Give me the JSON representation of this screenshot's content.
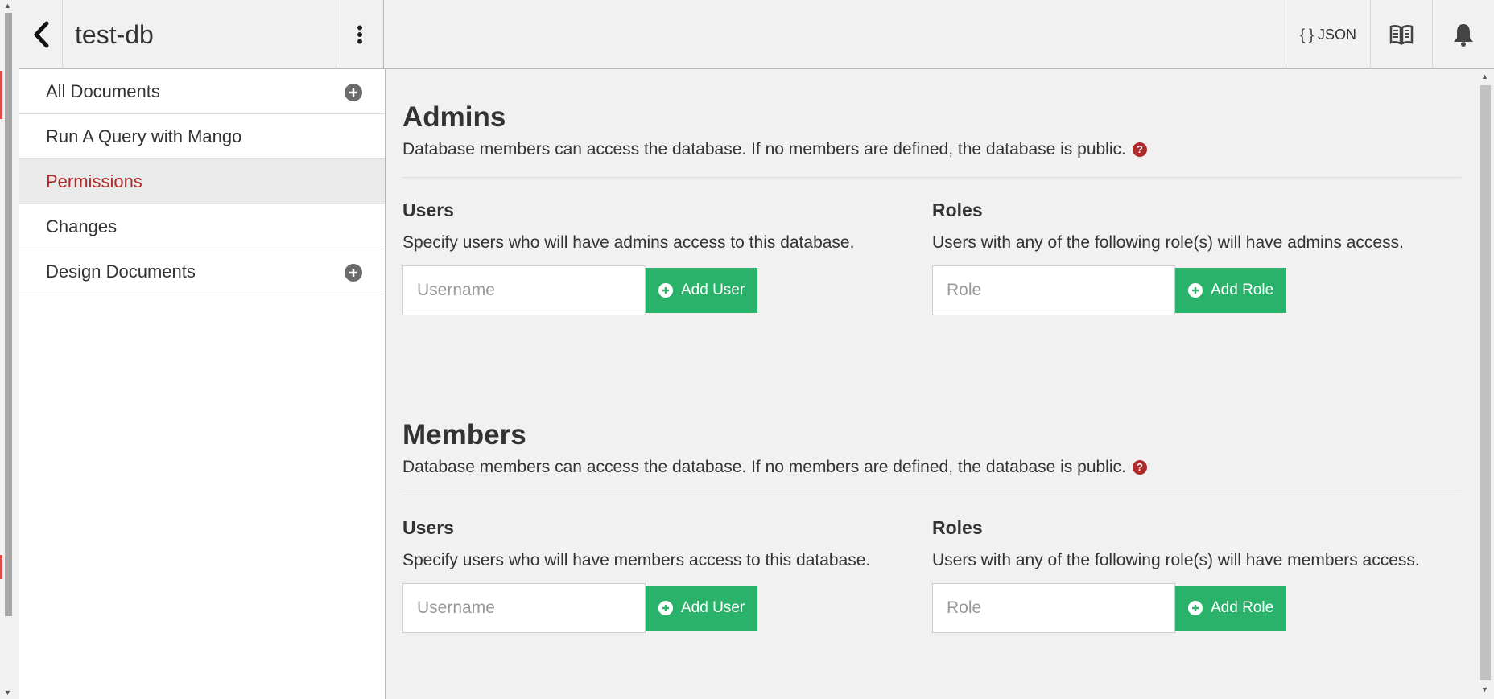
{
  "header": {
    "db_name": "test-db",
    "json_label": "{ } JSON",
    "icons": {
      "back": "chevron-left-icon",
      "menu": "kebab-menu-icon",
      "docs": "book-icon",
      "notifications": "bell-icon"
    }
  },
  "sidebar": {
    "items": [
      {
        "label": "All Documents",
        "has_add": true
      },
      {
        "label": "Run A Query with Mango",
        "has_add": false
      },
      {
        "label": "Permissions",
        "has_add": false,
        "active": true
      },
      {
        "label": "Changes",
        "has_add": false
      },
      {
        "label": "Design Documents",
        "has_add": true
      }
    ]
  },
  "admins": {
    "title": "Admins",
    "description": "Database members can access the database. If no members are defined, the database is public.",
    "users": {
      "heading": "Users",
      "hint": "Specify users who will have admins access to this database.",
      "placeholder": "Username",
      "button": "Add User"
    },
    "roles": {
      "heading": "Roles",
      "hint": "Users with any of the following role(s) will have admins access.",
      "placeholder": "Role",
      "button": "Add Role"
    }
  },
  "members": {
    "title": "Members",
    "description": "Database members can access the database. If no members are defined, the database is public.",
    "users": {
      "heading": "Users",
      "hint": "Specify users who will have members access to this database.",
      "placeholder": "Username",
      "button": "Add User"
    },
    "roles": {
      "heading": "Roles",
      "hint": "Users with any of the following role(s) will have members access.",
      "placeholder": "Role",
      "button": "Add Role"
    }
  },
  "colors": {
    "accent_green": "#2ab26b",
    "active_red": "#b12a2a",
    "background": "#f1f1f1"
  }
}
